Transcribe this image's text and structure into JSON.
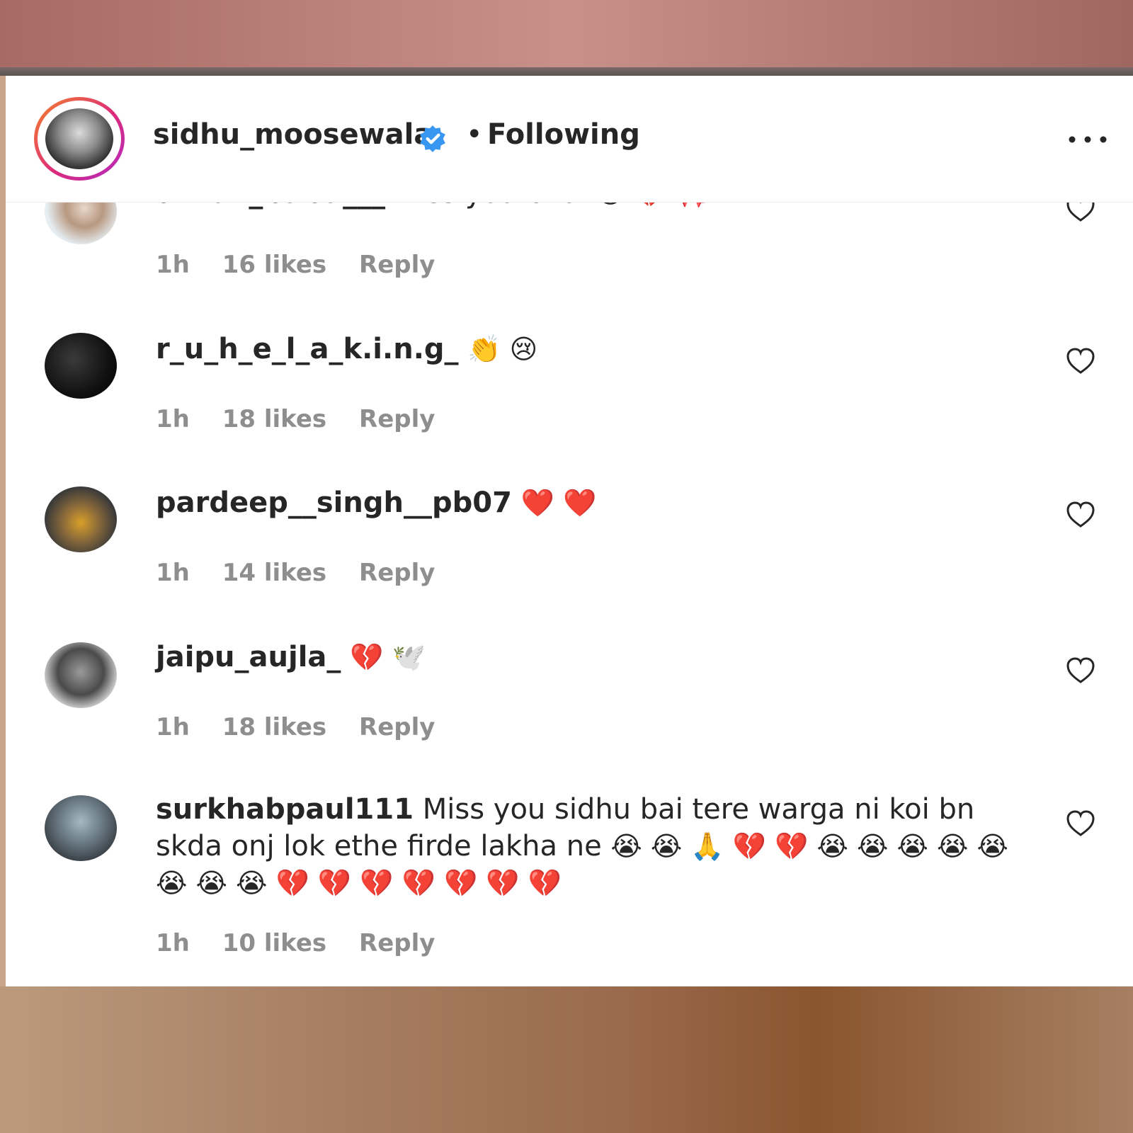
{
  "post": {
    "username": "sidhu_moosewala",
    "separator": "•",
    "follow_status": "Following"
  },
  "comments": [
    {
      "username": "dhruv_babu___",
      "text": "Miss you bhai",
      "emoji": "😢 💔 🎀",
      "time": "1h",
      "likes": "16 likes",
      "reply": "Reply"
    },
    {
      "username": "r_u_h_e_l_a_k.i.n.g_",
      "text": "",
      "emoji": "👏 😢",
      "time": "1h",
      "likes": "18 likes",
      "reply": "Reply"
    },
    {
      "username": "pardeep__singh__pb07",
      "text": "",
      "emoji": "❤️ ❤️",
      "time": "1h",
      "likes": "14 likes",
      "reply": "Reply"
    },
    {
      "username": "jaipu_aujla_",
      "text": "",
      "emoji": "💔 🕊️",
      "time": "1h",
      "likes": "18 likes",
      "reply": "Reply"
    },
    {
      "username": "surkhabpaul111",
      "text": "Miss you sidhu bai tere warga ni koi bn skda onj lok ethe firde lakha ne",
      "emoji": "😭 😭 🙏 💔 💔 😭 😭 😭 😭 😭 😭 😭 😭 💔 💔 💔 💔 💔 💔 💔",
      "time": "1h",
      "likes": "10 likes",
      "reply": "Reply"
    }
  ],
  "icons": {
    "verified": "verified-badge-icon",
    "more": "more-options-icon",
    "like": "heart-outline-icon"
  },
  "colors": {
    "text_primary": "#262626",
    "text_secondary": "#8e8e8e",
    "verified_blue": "#3897f0"
  }
}
